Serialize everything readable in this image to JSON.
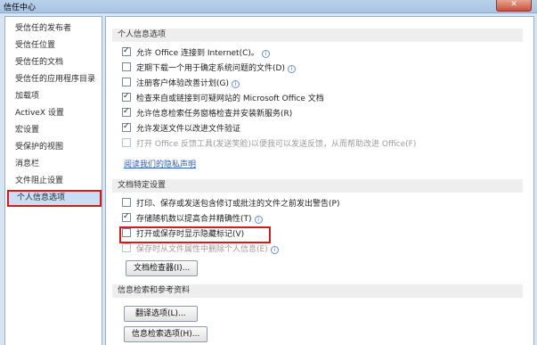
{
  "window": {
    "title": "信任中心",
    "close_label": "✕"
  },
  "sidebar": {
    "items": [
      {
        "label": "受信任的发布者"
      },
      {
        "label": "受信任位置"
      },
      {
        "label": "受信任的文档"
      },
      {
        "label": "受信任的应用程序目录"
      },
      {
        "label": "加载项"
      },
      {
        "label": "ActiveX 设置"
      },
      {
        "label": "宏设置"
      },
      {
        "label": "受保护的视图"
      },
      {
        "label": "消息栏"
      },
      {
        "label": "文件阻止设置"
      },
      {
        "label": "个人信息选项"
      }
    ],
    "selected": "个人信息选项"
  },
  "sections": {
    "personal": {
      "title": "个人信息选项",
      "options": [
        {
          "label": "允许 Office 连接到 Internet(C)。",
          "checked": true
        },
        {
          "label": "定期下载一个用于确定系统问题的文件(D)",
          "checked": false
        },
        {
          "label": "注册客户体验改善计划(G)",
          "checked": false
        },
        {
          "label": "检查来自或链接到可疑网站的 Microsoft Office 文档",
          "checked": true
        },
        {
          "label": "允许信息检索任务窗格检查并安装新服务(R)",
          "checked": true
        },
        {
          "label": "允许发送文件以改进文件验证",
          "checked": true
        },
        {
          "label": "打开 Office 反馈工具(发送笑脸)以便我可以发送反馈，从而帮助改进 Office(F)",
          "checked": false
        }
      ],
      "privacy_link": "阅读我们的隐私声明"
    },
    "document": {
      "title": "文档特定设置",
      "options": [
        {
          "label": "打印、保存或发送包含修订或批注的文件之前发出警告(P)",
          "checked": false
        },
        {
          "label": "存储随机数以提高合并精确性(T)",
          "checked": true
        },
        {
          "label": "打开或保存时显示隐藏标记(V)",
          "checked": false
        },
        {
          "label": "保存时从文件属性中删除个人信息(E)",
          "checked": false
        }
      ],
      "inspector_button": "文档检查器(I)..."
    },
    "research": {
      "title": "信息检索和参考资料",
      "translate_button": "翻译选项(L)...",
      "research_button": "信息检索选项(H)..."
    }
  },
  "colors": {
    "highlight": "#d01c1c",
    "link": "#2f5fb0",
    "selected_bg": "#c9def5"
  }
}
